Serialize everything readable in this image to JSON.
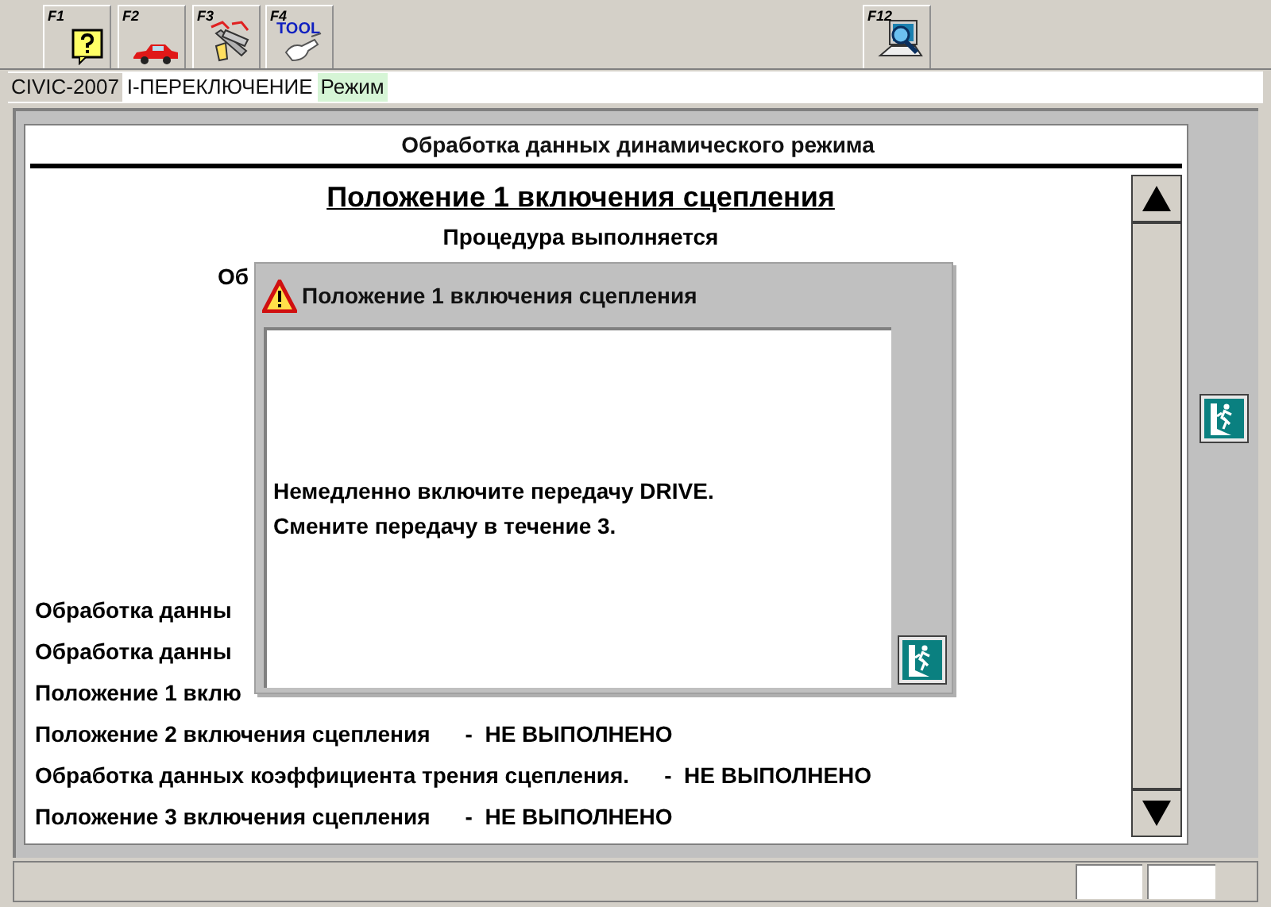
{
  "toolbar": {
    "buttons": [
      {
        "key": "F1",
        "kind": "help"
      },
      {
        "key": "F2",
        "kind": "car"
      },
      {
        "key": "F3",
        "kind": "switch"
      },
      {
        "key": "F4",
        "kind": "tool",
        "icon_text": "TOOL"
      },
      {
        "key": "F12",
        "kind": "scan"
      }
    ]
  },
  "context_bar": [
    {
      "text": "CIVIC-2007",
      "kind": "model"
    },
    {
      "text": "I-ПЕРЕКЛЮЧЕНИЕ",
      "kind": "system"
    },
    {
      "text": "Режим",
      "kind": "mode"
    }
  ],
  "panel": {
    "header": "Обработка данных динамического режима",
    "title": "Положение 1 включения сцепления",
    "subtitle": "Процедура выполняется",
    "partial_line": "Об",
    "steps": [
      {
        "label": "Обработка данны"
      },
      {
        "label": "Обработка данны"
      },
      {
        "label": "Положение 1 вклю"
      },
      {
        "label": "Положение 2 включения сцепления",
        "result": "-  НЕ ВЫПОЛНЕНО"
      },
      {
        "label": "Обработка данных коэффициента трения сцепления.",
        "result": "-  НЕ ВЫПОЛНЕНО"
      },
      {
        "label": "Положение 3 включения сцепления",
        "result": "-  НЕ ВЫПОЛНЕНО"
      }
    ]
  },
  "dialog": {
    "title": "Положение 1 включения сцепления",
    "message": [
      "Немедленно включите передачу DRIVE.",
      "Смените передачу в течение 3."
    ]
  }
}
